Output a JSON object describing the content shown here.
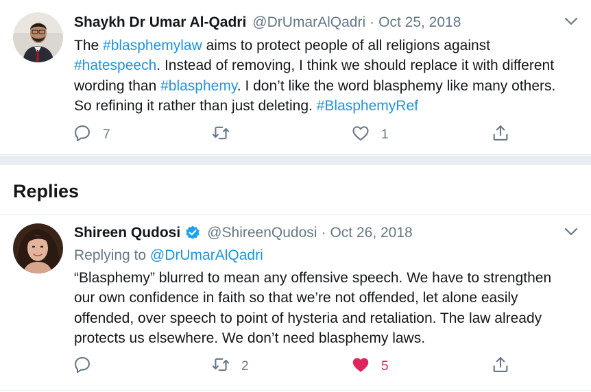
{
  "main_tweet": {
    "author_name": "Shaykh Dr Umar Al-Qadri",
    "handle": "@DrUmarAlQadri",
    "separator": "·",
    "date": "Oct 25, 2018",
    "text": {
      "p1": "The ",
      "h1": "#blasphemylaw",
      "p2": " aims to protect people of all religions against ",
      "h2": "#hatespeech",
      "p3": ". Instead of removing, I think we should replace it with different wording than ",
      "h3": "#blasphemy",
      "p4": ". I don’t like the word blasphemy like many others.  So refining it rather than just deleting. ",
      "h4": "#BlasphemyRef"
    },
    "actions": {
      "reply_count": "7",
      "retweet_count": "",
      "like_count": "1"
    }
  },
  "replies_section": {
    "title": "Replies"
  },
  "reply_tweet": {
    "author_name": "Shireen Qudosi",
    "handle": "@ShireenQudosi",
    "separator": "·",
    "date": "Oct 26, 2018",
    "replying_label": "Replying to ",
    "replying_to": "@DrUmarAlQadri",
    "text": "“Blasphemy” blurred to mean any offensive speech. We have to strengthen our own confidence in faith so that we’re not offended, let alone easily offended, over speech to point of hysteria and retaliation. The law already protects us elsewhere. We don’t need blasphemy laws.",
    "actions": {
      "reply_count": "",
      "retweet_count": "2",
      "like_count": "5",
      "liked": true
    }
  },
  "colors": {
    "link": "#1b95e0",
    "muted": "#657786",
    "like": "#e0245e",
    "verified": "#1da1f2",
    "divider": "#e6ecf0"
  },
  "icons": [
    "chevron-down-icon",
    "reply-icon",
    "retweet-icon",
    "like-icon",
    "share-icon",
    "verified-badge-icon"
  ]
}
